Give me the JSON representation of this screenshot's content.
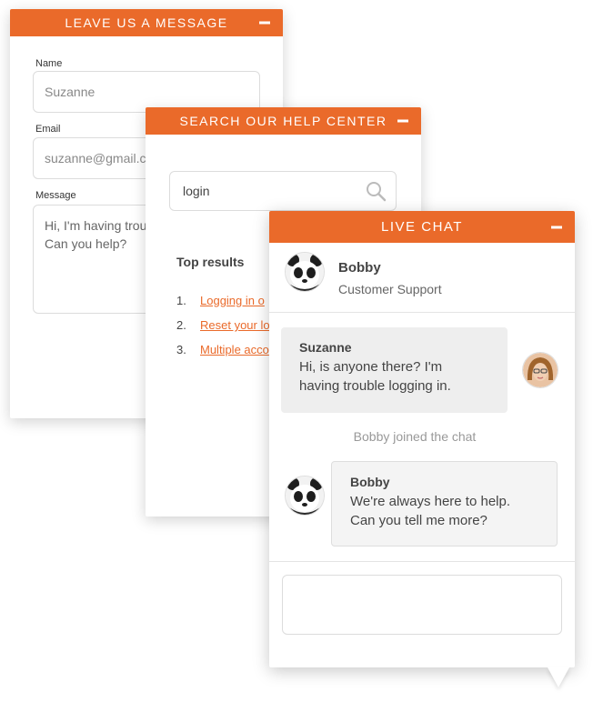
{
  "message_panel": {
    "title": "LEAVE US A MESSAGE",
    "name_label": "Name",
    "name_value": "Suzanne",
    "email_label": "Email",
    "email_value": "suzanne@gmail.c",
    "message_label": "Message",
    "message_value_line1": "Hi, I'm having troubl",
    "message_value_line2": "Can you help?"
  },
  "help_panel": {
    "title": "SEARCH OUR HELP CENTER",
    "search_value": "login",
    "top_results_label": "Top results",
    "results": [
      {
        "num": "1.",
        "label": "Logging in o"
      },
      {
        "num": "2.",
        "label": "Reset your lo"
      },
      {
        "num": "3.",
        "label": "Multiple acco"
      }
    ]
  },
  "chat_panel": {
    "title": "LIVE CHAT",
    "agent_name": "Bobby",
    "agent_role": "Customer Support",
    "messages": [
      {
        "sender": "Suzanne",
        "line1": "Hi, is anyone there? I'm",
        "line2": "having trouble logging in."
      },
      {
        "sender": "Bobby",
        "line1": "We're always here to help.",
        "line2": "Can you tell me more?"
      }
    ],
    "system_message": "Bobby joined the chat"
  },
  "colors": {
    "accent": "#ea6a2a",
    "link": "#ea6a2a"
  }
}
